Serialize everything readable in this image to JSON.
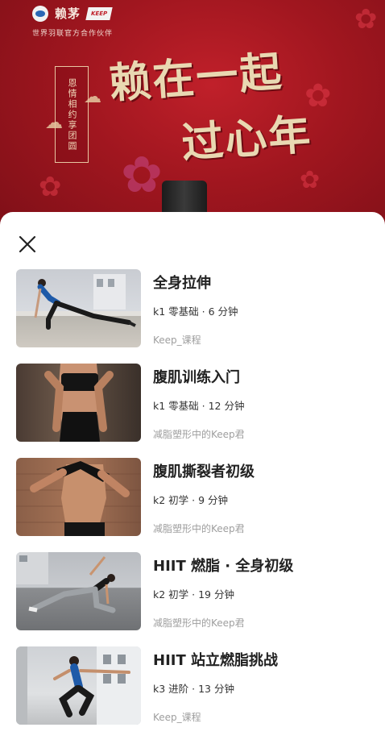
{
  "banner": {
    "brand_name": "赖茅",
    "brand_logo2": "KEEP",
    "brand_sub": "世界羽联官方合作伙伴",
    "scroll_text": "恩情相约享团圆",
    "slogan_line1": "赖在一起",
    "slogan_line2": "过心年",
    "colors": {
      "background": "#a0161f",
      "slogan": "#e9d8b2"
    }
  },
  "sheet": {
    "close_icon": "close-icon",
    "courses": [
      {
        "title": "全身拉伸",
        "meta": "k1 零基础 · 6 分钟",
        "author": "Keep_课程"
      },
      {
        "title": "腹肌训练入门",
        "meta": "k1 零基础 · 12 分钟",
        "author": "减脂塑形中的Keep君"
      },
      {
        "title": "腹肌撕裂者初级",
        "meta": "k2 初学 · 9 分钟",
        "author": "减脂塑形中的Keep君"
      },
      {
        "title": "HIIT 燃脂 · 全身初级",
        "meta": "k2 初学 · 19 分钟",
        "author": "减脂塑形中的Keep君"
      },
      {
        "title": "HIIT 站立燃脂挑战",
        "meta": "k3 进阶 · 13 分钟",
        "author": "Keep_课程"
      }
    ]
  }
}
